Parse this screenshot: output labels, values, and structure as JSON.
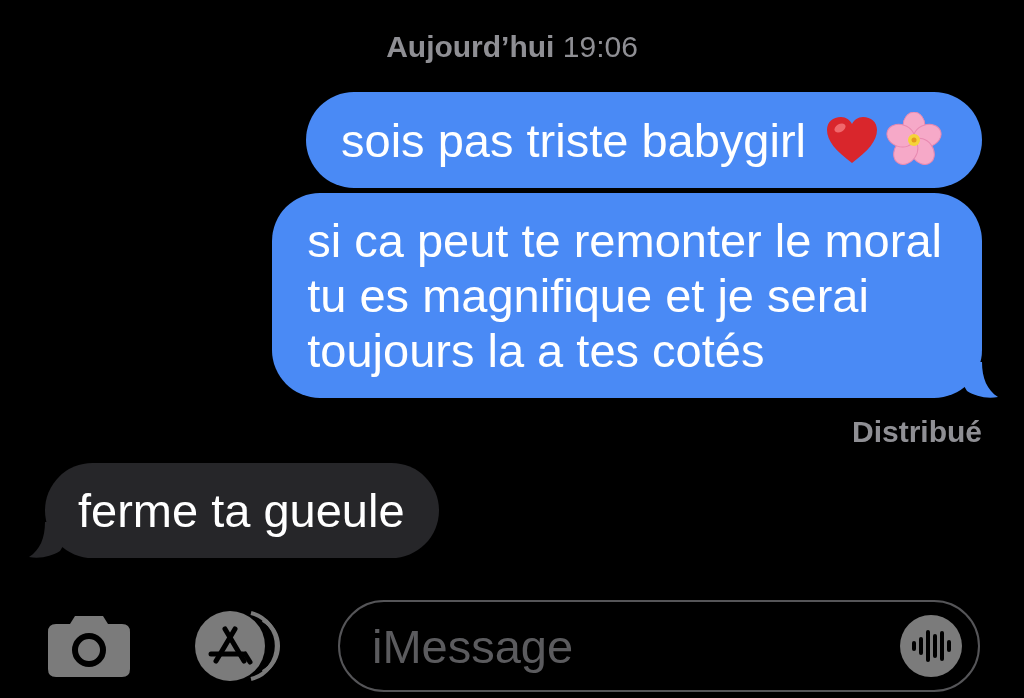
{
  "timestamp": "**Aujourd’hui** 19:06",
  "messages": [
    {
      "kind": "sent",
      "text": "sois pas triste babygirl",
      "emoji": [
        {
          "kind": "heart"
        },
        {
          "kind": "blossom"
        }
      ],
      "tail": false
    },
    {
      "kind": "sent",
      "text": "si ca peut te remonter le moral\ntu es magnifique et je serai\ntoujours la a tes cotés",
      "tail": true,
      "status": "Distribué"
    },
    {
      "kind": "received",
      "text": "ferme ta gueule",
      "tail": true
    }
  ],
  "input": {
    "placeholder": "iMessage"
  }
}
